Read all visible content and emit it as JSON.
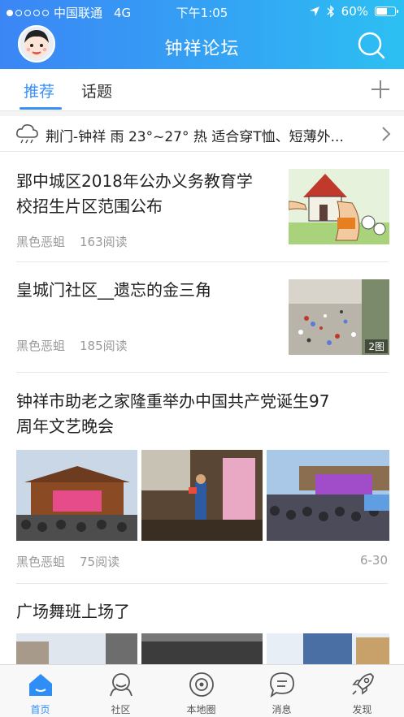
{
  "status_bar": {
    "carrier": "中国联通",
    "network": "4G",
    "time": "下午1:05",
    "battery": "60%",
    "battery_level": 0.6
  },
  "nav": {
    "title": "钟祥论坛",
    "avatar_icon": "avatar-icon",
    "search_icon": "search-icon"
  },
  "tabs": {
    "items": [
      {
        "label": "推荐",
        "active": true
      },
      {
        "label": "话题",
        "active": false
      }
    ],
    "add_icon": "plus-icon"
  },
  "weather": {
    "text": "荆门-钟祥 雨 23°~27° 热 适合穿T恤、短薄外...",
    "icon": "rain-cloud-icon"
  },
  "feed": [
    {
      "title_lines": [
        "郢中城区2018年公办义务教育学",
        "校招生片区范围公布"
      ],
      "author": "黑色恶蛆",
      "reads": "163阅读"
    },
    {
      "title_lines": [
        "皇城门社区__遗忘的金三角"
      ],
      "author": "黑色恶蛆",
      "reads": "185阅读",
      "thumb_badge": "2图"
    },
    {
      "title_lines": [
        "钟祥市助老之家隆重举办中国共产党诞生97",
        "周年文艺晚会"
      ],
      "author": "黑色恶蛆",
      "reads": "75阅读",
      "date": "6-30"
    },
    {
      "title_lines": [
        "广场舞班上场了"
      ]
    }
  ],
  "bottom_nav": {
    "items": [
      {
        "label": "首页",
        "icon": "home-icon",
        "active": true
      },
      {
        "label": "社区",
        "icon": "community-icon",
        "active": false
      },
      {
        "label": "本地圈",
        "icon": "local-circle-icon",
        "active": false
      },
      {
        "label": "消息",
        "icon": "message-icon",
        "active": false
      },
      {
        "label": "发现",
        "icon": "rocket-icon",
        "active": false
      }
    ]
  },
  "colors": {
    "header_start": "#3b86f5",
    "header_end": "#2cc0f2",
    "accent": "#3a8ff5",
    "meta_text": "#9a9a9a"
  }
}
